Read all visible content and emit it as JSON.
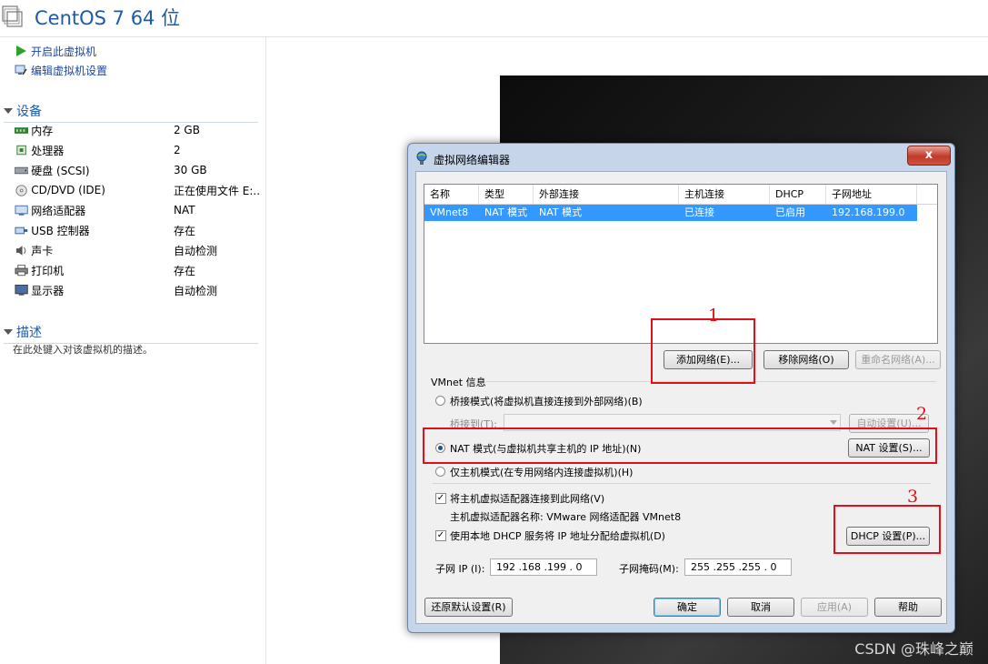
{
  "header": {
    "title": "CentOS 7 64 位"
  },
  "actions": [
    {
      "label": "开启此虚拟机",
      "icon": "play-icon"
    },
    {
      "label": "编辑虚拟机设置",
      "icon": "edit-settings-icon"
    }
  ],
  "devices_section": {
    "title": "设备",
    "items": [
      {
        "name": "内存",
        "value": "2 GB",
        "icon": "memory-icon"
      },
      {
        "name": "处理器",
        "value": "2",
        "icon": "cpu-icon"
      },
      {
        "name": "硬盘 (SCSI)",
        "value": "30 GB",
        "icon": "disk-icon"
      },
      {
        "name": "CD/DVD (IDE)",
        "value": "正在使用文件 E:...",
        "icon": "cd-icon"
      },
      {
        "name": "网络适配器",
        "value": "NAT",
        "icon": "network-icon"
      },
      {
        "name": "USB 控制器",
        "value": "存在",
        "icon": "usb-icon"
      },
      {
        "name": "声卡",
        "value": "自动检测",
        "icon": "sound-icon"
      },
      {
        "name": "打印机",
        "value": "存在",
        "icon": "printer-icon"
      },
      {
        "name": "显示器",
        "value": "自动检测",
        "icon": "monitor-icon"
      }
    ]
  },
  "description_section": {
    "title": "描述",
    "placeholder": "在此处键入对该虚拟机的描述。"
  },
  "dialog": {
    "title": "虚拟网络编辑器",
    "close_label": "x",
    "table": {
      "columns": [
        "名称",
        "类型",
        "外部连接",
        "主机连接",
        "DHCP",
        "子网地址"
      ],
      "rows": [
        [
          "VMnet8",
          "NAT 模式",
          "NAT 模式",
          "已连接",
          "已启用",
          "192.168.199.0"
        ]
      ]
    },
    "buttons": {
      "add_network": "添加网络(E)...",
      "remove_network": "移除网络(O)",
      "rename_network": "重命名网络(A)...",
      "auto_settings": "自动设置(U)...",
      "nat_settings": "NAT 设置(S)...",
      "dhcp_settings": "DHCP 设置(P)...",
      "restore_defaults": "还原默认设置(R)",
      "ok": "确定",
      "cancel": "取消",
      "apply": "应用(A)",
      "help": "帮助"
    },
    "vmnet_info": {
      "title": "VMnet 信息",
      "bridged_mode": "桥接模式(将虚拟机直接连接到外部网络)(B)",
      "bridged_to_label": "桥接到(T):",
      "bridged_to_value": "",
      "nat_mode": "NAT 模式(与虚拟机共享主机的 IP 地址)(N)",
      "host_only_mode": "仅主机模式(在专用网络内连接虚拟机)(H)",
      "selected_mode": "nat",
      "connect_host_adapter": "将主机虚拟适配器连接到此网络(V)",
      "connect_host_adapter_checked": true,
      "adapter_name_label": "主机虚拟适配器名称: VMware 网络适配器 VMnet8",
      "use_local_dhcp": "使用本地 DHCP 服务将 IP 地址分配给虚拟机(D)",
      "use_local_dhcp_checked": true,
      "subnet_ip_label": "子网 IP (I):",
      "subnet_ip_value": "192 .168 .199 . 0",
      "subnet_mask_label": "子网掩码(M):",
      "subnet_mask_value": "255 .255 .255 . 0"
    }
  },
  "annotations": {
    "one": "1",
    "two": "2",
    "three": "3",
    "color": "#e0101a"
  },
  "watermark": "CSDN @珠峰之巅"
}
